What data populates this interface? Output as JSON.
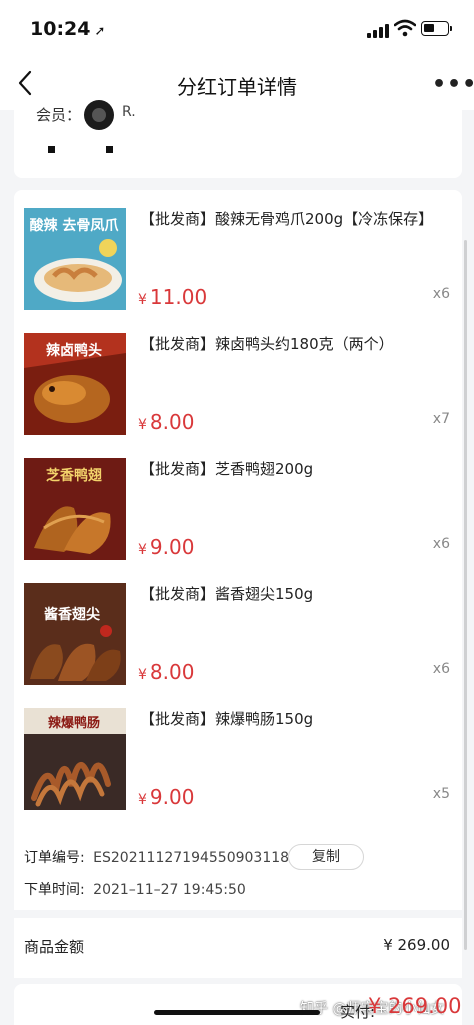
{
  "status": {
    "time": "10:24"
  },
  "nav": {
    "title": "分红订单详情"
  },
  "member": {
    "label": "会员：",
    "name": "R."
  },
  "products": [
    {
      "title": "【批发商】酸辣无骨鸡爪200g【冷冻保存】",
      "currency": "¥",
      "price": "11.00",
      "qty": "x6",
      "image_text": "酸辣 去骨凤爪",
      "bg": "#4fa9c6"
    },
    {
      "title": "【批发商】辣卤鸭头约180克（两个）",
      "currency": "¥",
      "price": "8.00",
      "qty": "x7",
      "image_text": "辣卤鸭头",
      "bg": "#b3321e"
    },
    {
      "title": "【批发商】芝香鸭翅200g",
      "currency": "¥",
      "price": "9.00",
      "qty": "x6",
      "image_text": "芝香鸭翅",
      "bg": "#6e1b14"
    },
    {
      "title": "【批发商】酱香翅尖150g",
      "currency": "¥",
      "price": "8.00",
      "qty": "x6",
      "image_text": "酱香翅尖",
      "bg": "#5a2d1b"
    },
    {
      "title": "【批发商】辣爆鸭肠150g",
      "currency": "¥",
      "price": "9.00",
      "qty": "x5",
      "image_text": "辣爆鸭肠",
      "bg": "#3a2a26"
    }
  ],
  "order": {
    "number_label": "订单编号:",
    "number": "ES20211127194550903118",
    "copy_label": "复制",
    "time_label": "下单时间:",
    "time": "2021–11–27 19:45:50"
  },
  "summary": {
    "goods_amount_label": "商品金额",
    "goods_amount": "¥ 269.00",
    "paid_label": "实付:",
    "paid": "¥ 269.00"
  },
  "watermark": "知乎 @师宝宝的小仙女",
  "colors": {
    "price": "#d9383a",
    "background": "#f4f5f7"
  }
}
